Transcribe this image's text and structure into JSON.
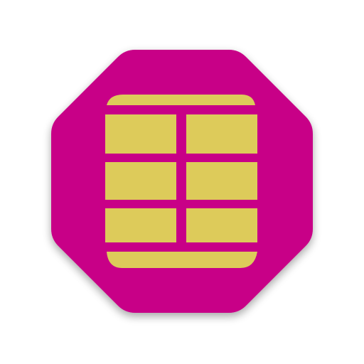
{
  "icon": {
    "name": "sim-card-chip-icon",
    "shape": "rounded-octagon",
    "colors": {
      "background": "#ffffff",
      "frame": "#c80087",
      "chip": "#ddcb5a",
      "shadow": "#000000"
    }
  }
}
